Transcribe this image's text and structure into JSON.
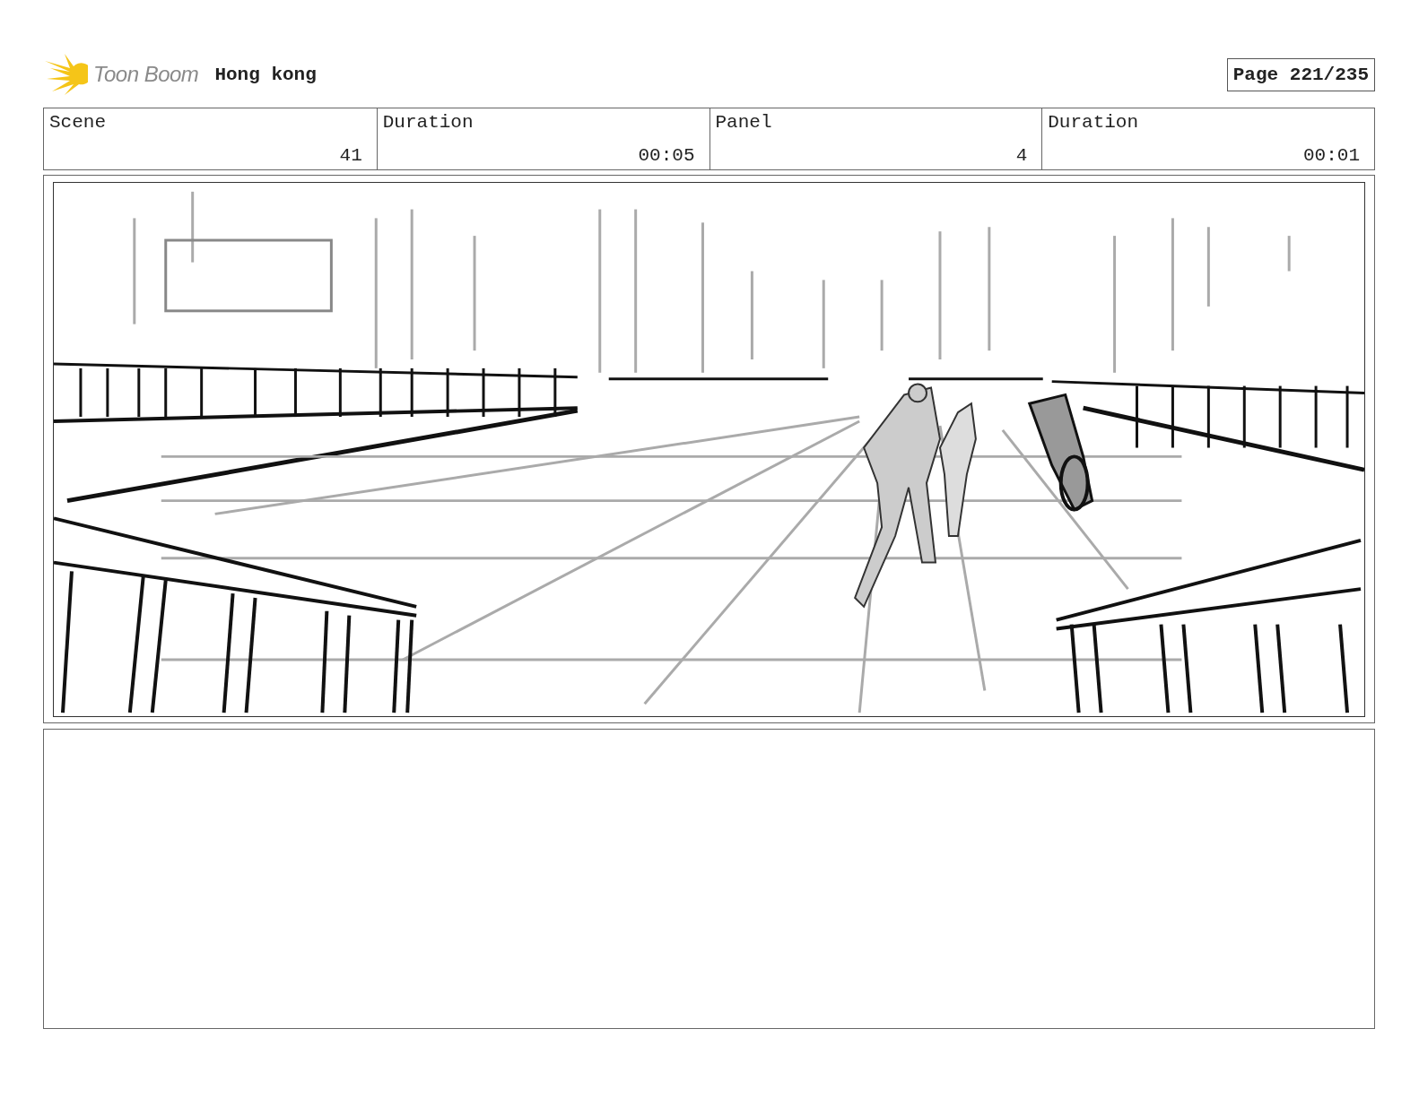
{
  "header": {
    "logo_text": "Toon Boom",
    "project_title": "Hong kong",
    "page": "Page 221/235"
  },
  "info": [
    {
      "label": "Scene",
      "value": "41"
    },
    {
      "label": "Duration",
      "value": "00:05"
    },
    {
      "label": "Panel",
      "value": "4"
    },
    {
      "label": "Duration",
      "value": "00:01"
    }
  ]
}
